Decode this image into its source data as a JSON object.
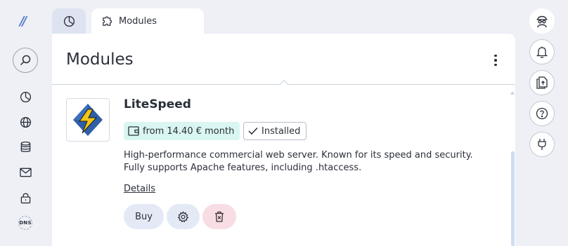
{
  "sidebar": {
    "logo": "//",
    "items": [
      {
        "name": "dashboard",
        "icon": "pie-chart-icon"
      },
      {
        "name": "domains",
        "icon": "globe-icon"
      },
      {
        "name": "databases",
        "icon": "database-icon"
      },
      {
        "name": "email",
        "icon": "mail-icon"
      },
      {
        "name": "security",
        "icon": "lock-icon"
      },
      {
        "name": "dns",
        "icon": "dns-icon",
        "label": "DNS"
      }
    ]
  },
  "tabs": {
    "home_icon": "pie-chart-icon",
    "active_label": "Modules"
  },
  "main": {
    "title": "Modules",
    "module": {
      "name": "LiteSpeed",
      "price": "from 14.40 € month",
      "status": "Installed",
      "description": "High-performance commercial web server. Known for its speed and security. Fully supports Apache features, including .htaccess.",
      "details_label": "Details",
      "buy_label": "Buy"
    }
  },
  "right_sidebar": {
    "items": [
      "avatar-icon",
      "bell-icon",
      "file-upload-icon",
      "help-icon",
      "plugin-icon"
    ]
  },
  "colors": {
    "background": "#eef0f6",
    "price_chip": "#d9f6f2",
    "buy_button": "#e4e9f6",
    "delete_button": "#f8dde4",
    "accent": "#5a7fcb"
  }
}
